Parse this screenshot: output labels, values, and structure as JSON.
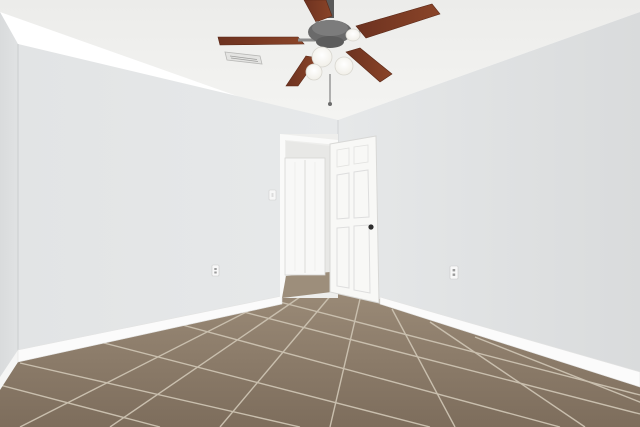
{
  "scene": {
    "colors": {
      "ceiling": "#f1f1ef",
      "wall_back": "#e4e6e7",
      "wall_right": "#e1e3e4",
      "wall_left": "#dfe1e2",
      "floor": "#8b7a68",
      "grout": "#c9bfae",
      "baseboard": "#fbfbfb",
      "door": "#f7f7f5",
      "fan_blade": "#7a3a22"
    },
    "objects": [
      "ceiling-fan",
      "open-door",
      "closet-door",
      "tile-floor",
      "baseboards",
      "light-switch",
      "wall-outlet"
    ]
  }
}
